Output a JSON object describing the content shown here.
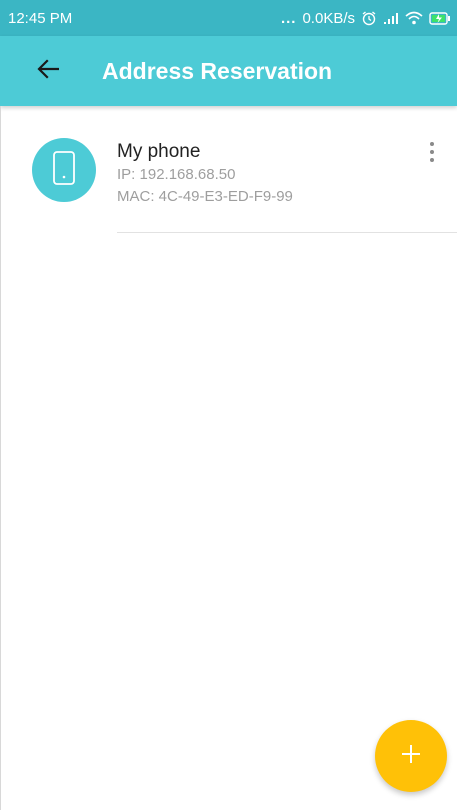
{
  "status_bar": {
    "time": "12:45 PM",
    "dots": "...",
    "net_speed": "0.0KB/s"
  },
  "app_bar": {
    "title": "Address Reservation"
  },
  "reservations": [
    {
      "name": "My phone",
      "ip": "IP: 192.168.68.50",
      "mac": "MAC: 4C-49-E3-ED-F9-99",
      "icon": "phone-icon"
    }
  ],
  "icons": {
    "back": "arrow-left-icon",
    "more": "more-vert-icon",
    "add": "plus-icon"
  },
  "colors": {
    "status_bar": "#3bb6c4",
    "app_bar": "#4dcbd6",
    "fab": "#ffc107",
    "text_primary": "#222222",
    "text_secondary": "#9e9e9e"
  }
}
